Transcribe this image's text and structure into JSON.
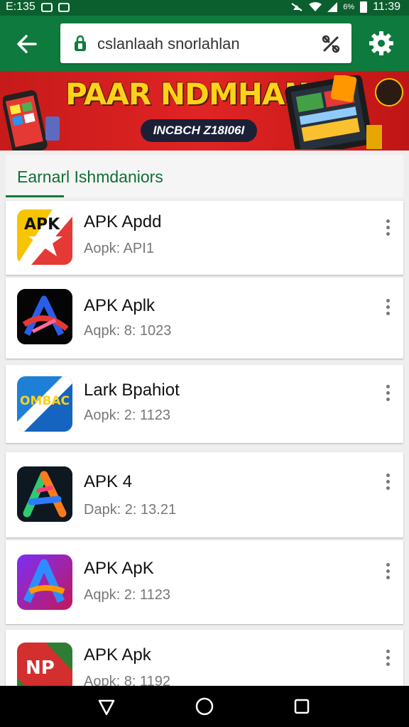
{
  "status_bar": {
    "left_text": "E:135",
    "right_text": "6%",
    "time": "11:39"
  },
  "search": {
    "text": "cslanlaah snorlahlan"
  },
  "banner": {
    "title": "PAAR NDMHAN",
    "subtitle": "INCBCH Z18I06I"
  },
  "section": {
    "title": "Earnarl Ishmdaniors"
  },
  "apps": [
    {
      "name": "APK Apdd",
      "meta": "Aopk: API1",
      "icon": "apk-star-icon",
      "icon_text": "APK"
    },
    {
      "name": "APK Aplk",
      "meta": "Aqpk: 8: 1023",
      "icon": "neon-a-icon",
      "icon_text": ""
    },
    {
      "name": "Lark Bpahiot",
      "meta": "Aopk: 2: 1123",
      "icon": "blue-ombac-icon",
      "icon_text": "OMBAC"
    },
    {
      "name": "APK 4",
      "meta": "Dapk: 2: 13.21",
      "icon": "rainbow-a-icon",
      "icon_text": ""
    },
    {
      "name": "APK ApK",
      "meta": "Aqpk: 2: 1123",
      "icon": "purple-a-icon",
      "icon_text": ""
    },
    {
      "name": "APK Apk",
      "meta": "Aopk: 8: 1192",
      "icon": "red-np-icon",
      "icon_text": "NP"
    }
  ],
  "colors": {
    "appbar": "#0f7a3d",
    "statusbar": "#0b5e2e",
    "banner": "#d91f1f",
    "accent": "#ffd21a"
  }
}
